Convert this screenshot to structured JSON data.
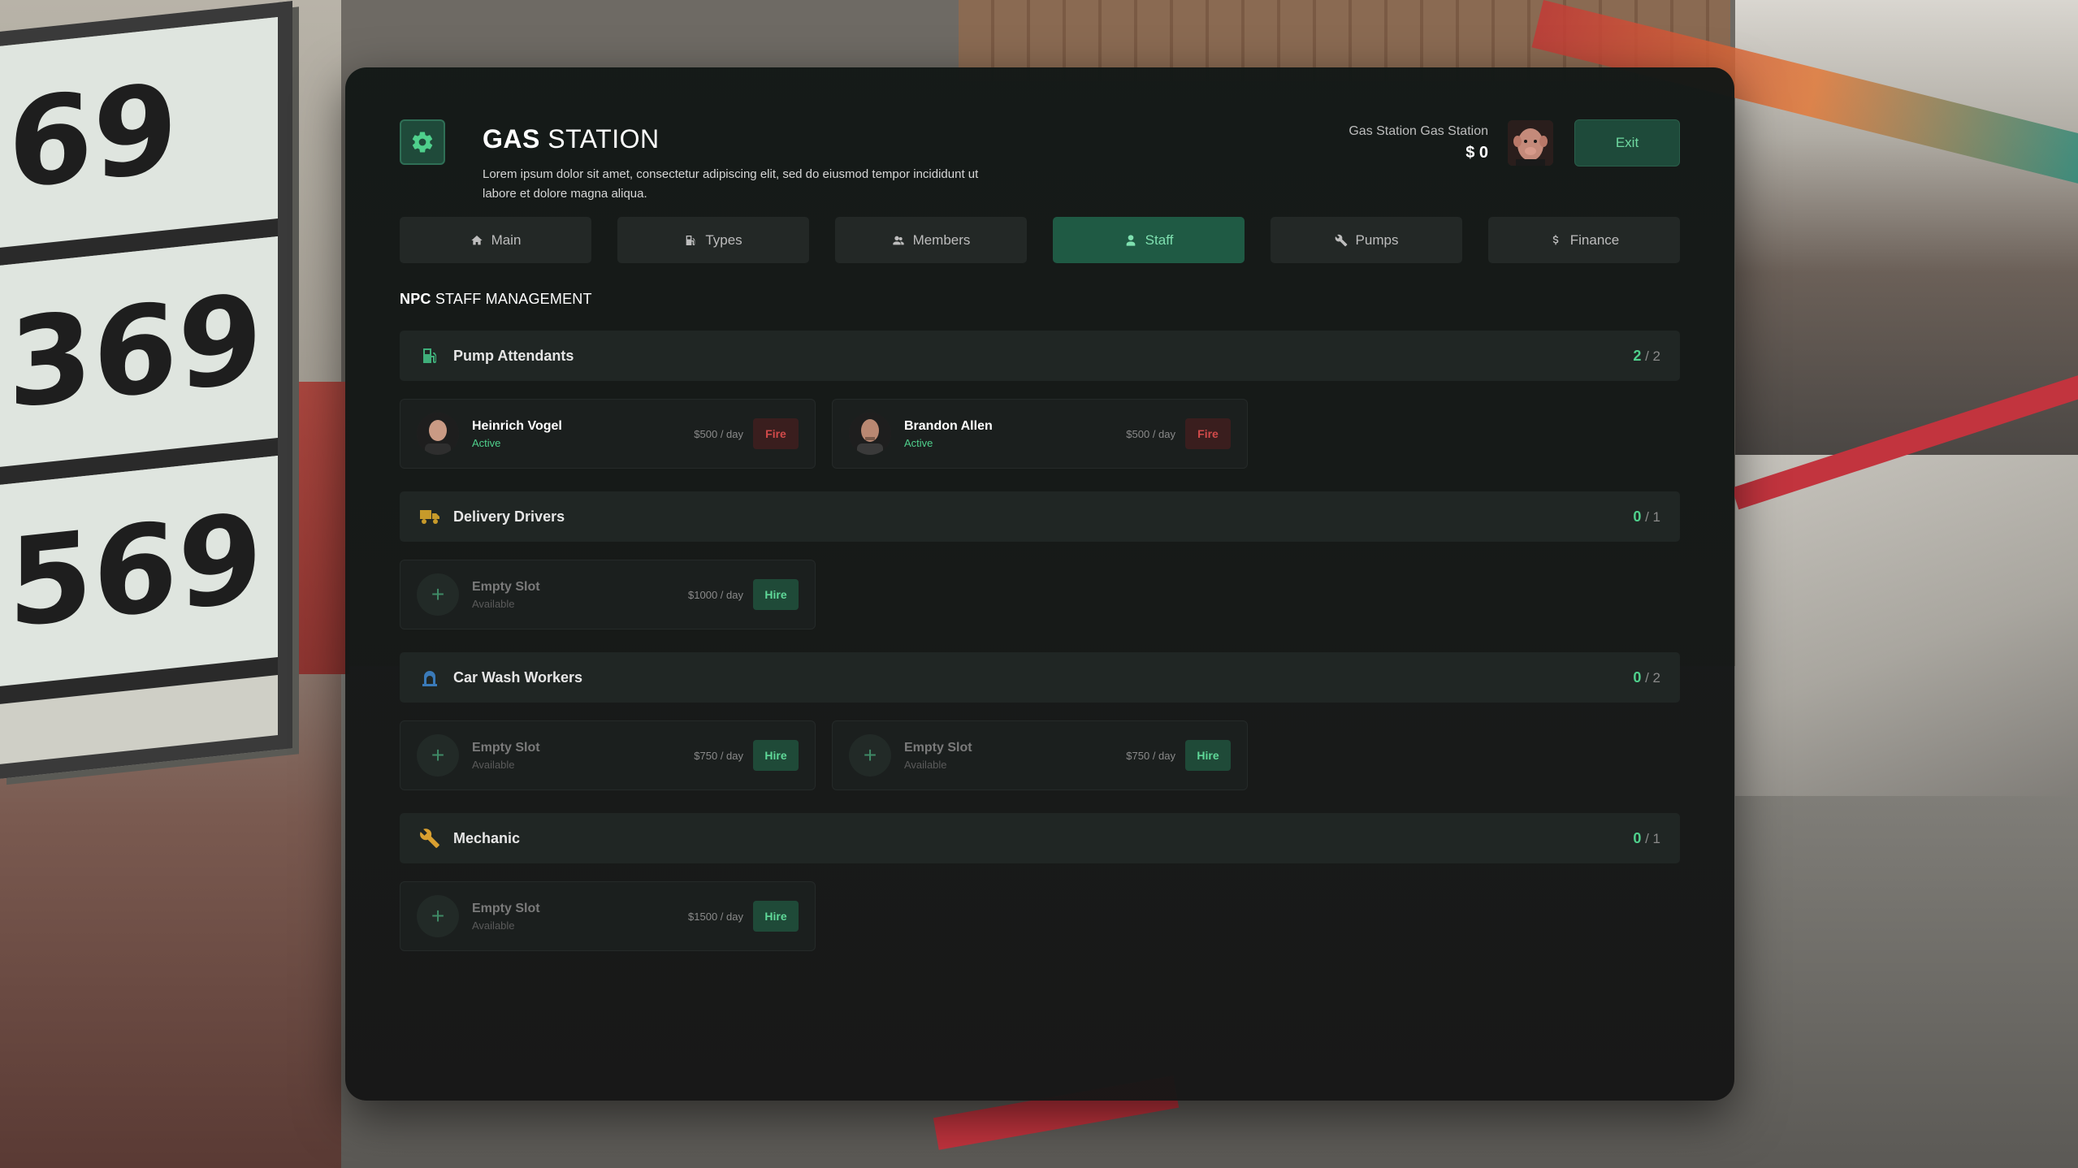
{
  "header": {
    "title_bold": "GAS",
    "title_light": "STATION",
    "description": "Lorem ipsum dolor sit amet, consectetur adipiscing elit, sed do eiusmod tempor incididunt ut labore et dolore magna aliqua.",
    "user_name": "Gas Station Gas Station",
    "user_money": "$ 0",
    "exit_label": "Exit"
  },
  "tabs": [
    {
      "label": "Main",
      "icon": "home-icon",
      "active": false
    },
    {
      "label": "Types",
      "icon": "fuel-icon",
      "active": false
    },
    {
      "label": "Members",
      "icon": "users-icon",
      "active": false
    },
    {
      "label": "Staff",
      "icon": "user-icon",
      "active": true
    },
    {
      "label": "Pumps",
      "icon": "wrench-icon",
      "active": false
    },
    {
      "label": "Finance",
      "icon": "dollar-icon",
      "active": false
    }
  ],
  "section": {
    "bold": "NPC",
    "rest": "STAFF MANAGEMENT"
  },
  "categories": [
    {
      "title": "Pump Attendants",
      "icon": "fuel-pump-icon",
      "filled": "2",
      "total": "/ 2",
      "slots": [
        {
          "name": "Heinrich Vogel",
          "status": "Active",
          "price": "$500 / day",
          "action": "Fire"
        },
        {
          "name": "Brandon Allen",
          "status": "Active",
          "price": "$500 / day",
          "action": "Fire"
        }
      ]
    },
    {
      "title": "Delivery Drivers",
      "icon": "truck-icon",
      "filled": "0",
      "total": "/ 1",
      "slots": [
        {
          "name": "Empty Slot",
          "status": "Available",
          "price": "$1000 / day",
          "action": "Hire"
        }
      ]
    },
    {
      "title": "Car Wash Workers",
      "icon": "car-wash-icon",
      "filled": "0",
      "total": "/ 2",
      "slots": [
        {
          "name": "Empty Slot",
          "status": "Available",
          "price": "$750 / day",
          "action": "Hire"
        },
        {
          "name": "Empty Slot",
          "status": "Available",
          "price": "$750 / day",
          "action": "Hire"
        }
      ]
    },
    {
      "title": "Mechanic",
      "icon": "wrench-icon",
      "filled": "0",
      "total": "/ 1",
      "slots": [
        {
          "name": "Empty Slot",
          "status": "Available",
          "price": "$1500 / day",
          "action": "Hire"
        }
      ]
    }
  ],
  "colors": {
    "accent": "#4fd08c",
    "fire": "#d24a4a",
    "panel": "#161a19"
  }
}
